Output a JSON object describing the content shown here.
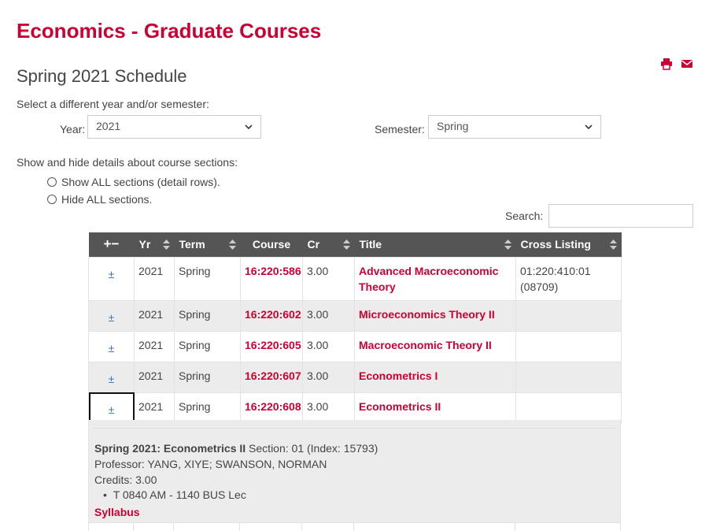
{
  "page": {
    "title": "Economics - Graduate Courses",
    "subtitle": "Spring 2021 Schedule"
  },
  "toolbar": {
    "print_icon": "print-icon",
    "email_icon": "envelope-icon"
  },
  "selector": {
    "instructions": "Select a different year and/or semester:",
    "year_label": "Year:",
    "year_value": "2021",
    "semester_label": "Semester:",
    "semester_value": "Spring"
  },
  "sections": {
    "instructions": "Show and hide details about course sections:",
    "show_all": "Show ALL sections (detail rows).",
    "hide_all": "Hide ALL sections."
  },
  "search": {
    "label": "Search:",
    "value": ""
  },
  "table": {
    "headers": {
      "toggle": "+−",
      "yr": "Yr",
      "term": "Term",
      "course": "Course",
      "cr": "Cr",
      "title": "Title",
      "cross": "Cross Listing"
    },
    "rows": [
      {
        "toggle": "±",
        "yr": "2021",
        "term": "Spring",
        "course": "16:220:586",
        "cr": "3.00",
        "title": "Advanced Macroeconomic Theory",
        "cross": "01:220:410:01 (08709)"
      },
      {
        "toggle": "±",
        "yr": "2021",
        "term": "Spring",
        "course": "16:220:602",
        "cr": "3.00",
        "title": "Microeconomics Theory II",
        "cross": ""
      },
      {
        "toggle": "±",
        "yr": "2021",
        "term": "Spring",
        "course": "16:220:605",
        "cr": "3.00",
        "title": "Macroeconomic Theory II",
        "cross": ""
      },
      {
        "toggle": "±",
        "yr": "2021",
        "term": "Spring",
        "course": "16:220:607",
        "cr": "3.00",
        "title": "Econometrics I",
        "cross": ""
      },
      {
        "toggle": "±",
        "yr": "2021",
        "term": "Spring",
        "course": "16:220:608",
        "cr": "3.00",
        "title": "Econometrics II",
        "cross": ""
      }
    ]
  },
  "detail": {
    "heading_bold": "Spring 2021: Econometrics II",
    "heading_rest": " Section: 01 (Index: 15793)",
    "professor": "Professor: YANG, XIYE; SWANSON, NORMAN",
    "credits": "Credits: 3.00",
    "meeting": "T 0840 AM - 1140 BUS Lec",
    "syllabus": "Syllabus"
  },
  "colors": {
    "accent": "#cc0033",
    "header_bg": "#555555",
    "toggle": "#3a7bbf"
  }
}
